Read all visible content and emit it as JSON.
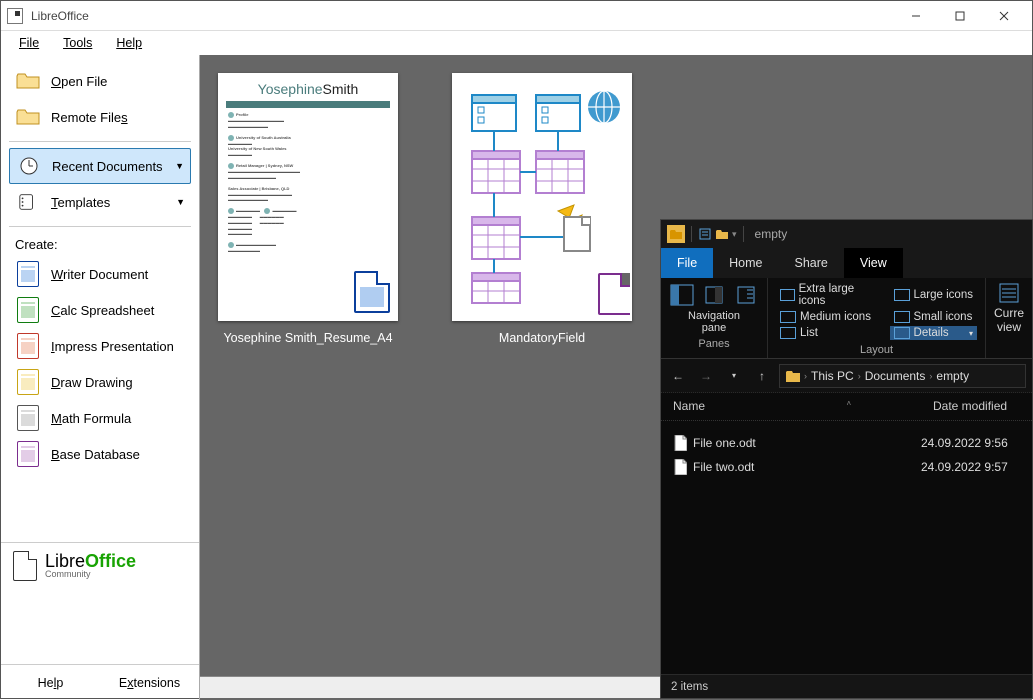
{
  "libreoffice": {
    "title": "LibreOffice",
    "menubar": {
      "file": "File",
      "tools": "Tools",
      "help": "Help"
    },
    "sidebar": {
      "open_file": "Open File",
      "remote_files": "Remote Files",
      "recent_documents": "Recent Documents",
      "templates": "Templates",
      "create_label": "Create:",
      "writer": "Writer Document",
      "calc": "Calc Spreadsheet",
      "impress": "Impress Presentation",
      "draw": "Draw Drawing",
      "math": "Math Formula",
      "base": "Base Database",
      "logo_main": "Libre",
      "logo_bold": "Office",
      "logo_sub": "Community",
      "help": "Help",
      "extensions": "Extensions"
    },
    "documents": [
      {
        "caption": "Yosephine Smith_Resume_A4",
        "thumb_title_a": "Yosephine",
        "thumb_title_b": "Smith"
      },
      {
        "caption": "MandatoryField"
      }
    ]
  },
  "explorer": {
    "title": "empty",
    "tabs": {
      "file": "File",
      "home": "Home",
      "share": "Share",
      "view": "View"
    },
    "ribbon": {
      "navigation_pane": "Navigation\npane",
      "panes": "Panes",
      "layout": "Layout",
      "extra_large": "Extra large icons",
      "large": "Large icons",
      "medium": "Medium icons",
      "small": "Small icons",
      "list": "List",
      "details": "Details",
      "current_view_a": "Curre",
      "current_view_b": "view"
    },
    "breadcrumbs": [
      "This PC",
      "Documents",
      "empty"
    ],
    "columns": {
      "name": "Name",
      "date": "Date modified"
    },
    "files": [
      {
        "name": "File one.odt",
        "date": "24.09.2022 9:56"
      },
      {
        "name": "File two.odt",
        "date": "24.09.2022 9:57"
      }
    ],
    "status": "2 items"
  }
}
